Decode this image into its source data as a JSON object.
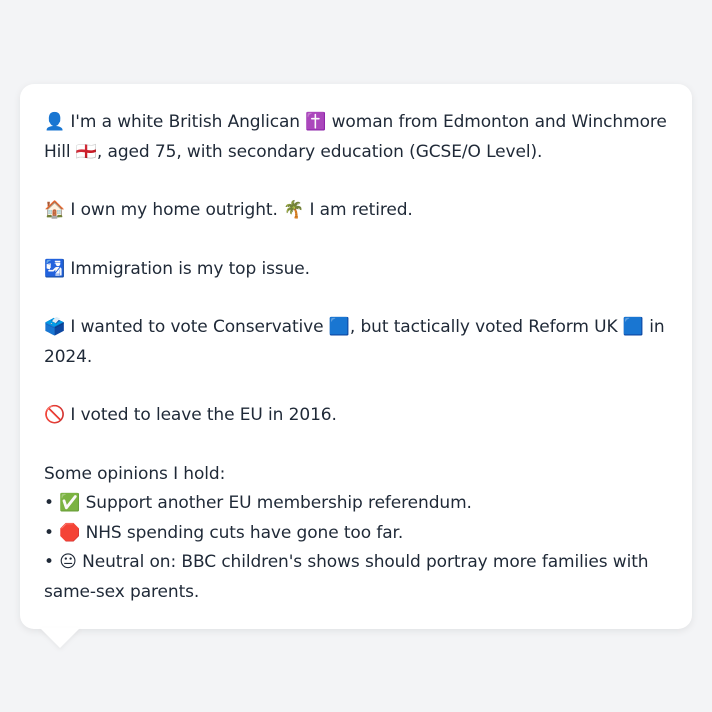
{
  "card": {
    "identity": "👤 I'm a white British Anglican ✝️ woman from Edmonton and Winchmore Hill 🏴󠁧󠁢󠁥󠁮󠁧󠁿, aged 75, with secondary education (GCSE/O Level).",
    "home": "🏠 I own my home outright. 🌴 I am retired.",
    "issue": "🛂 Immigration is my top issue.",
    "vote": "🗳️ I wanted to vote Conservative 🟦, but tactically voted Reform UK 🟦 in 2024.",
    "brexit": "🚫 I voted to leave the EU in 2016.",
    "opinions_heading": "Some opinions I hold:",
    "opinions": [
      "• ✅ Support another EU membership referendum.",
      "• 🛑 NHS spending cuts have gone too far.",
      "• 😐 Neutral on: BBC children's shows should portray more families with same-sex parents."
    ]
  }
}
